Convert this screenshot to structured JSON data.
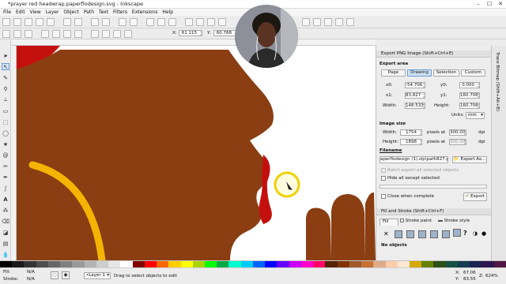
{
  "window": {
    "title": "*prayer red headwrap.paperflodesign.svg - Inkscape",
    "min": "–",
    "max": "☐",
    "close": "✕"
  },
  "menu": [
    "File",
    "Edit",
    "View",
    "Layer",
    "Object",
    "Path",
    "Text",
    "Filters",
    "Extensions",
    "Help"
  ],
  "toolctl": {
    "x_label": "X:",
    "x_value": "61.115",
    "y_label": "Y:",
    "y_value": "60.768"
  },
  "export": {
    "title": "Export PNG Image (Shift+Ctrl+E)",
    "area_label": "Export area",
    "tabs": [
      "Page",
      "Drawing",
      "Selection",
      "Custom"
    ],
    "x0_label": "x0:",
    "x0": "-54.706",
    "y0_label": "y0:",
    "y0": "0.000",
    "x1_label": "x1:",
    "x1": "83.827",
    "y1_label": "y1:",
    "y1": "160.706",
    "width_label": "Width:",
    "width": "148.533",
    "height_label": "Height:",
    "height": "160.706",
    "units_label": "Units:",
    "units": "mm",
    "image_size_label": "Image size",
    "img_width_label": "Width:",
    "img_width": "1754",
    "img_height_label": "Height:",
    "img_height": "1898",
    "pixels_at": "pixels at",
    "dpi1": "300.00",
    "dpi2": "300.00",
    "dpi_unit": "dpi",
    "filename_label": "Filename",
    "filename": "aperflodesign (1).zip\\path827.png",
    "export_as": "Export As...",
    "batch": "Batch export all selected objects",
    "hide": "Hide all except selected",
    "close_when": "Close when complete",
    "export_btn": "Export"
  },
  "fill_stroke": {
    "title": "Fill and Stroke (Shift+Ctrl+F)",
    "tabs": [
      "Fill",
      "Stroke paint",
      "Stroke style"
    ],
    "no_objects": "No objects"
  },
  "trace_tab": "Trace Bitmap (Shift+Alt+B)",
  "status": {
    "fill_label": "Fill:",
    "fill_value": "N/A",
    "stroke_label": "Stroke:",
    "stroke_value": "N/A",
    "layer": "•Layer 1",
    "message": "Drag to select objects to edit",
    "x_label": "X:",
    "x_value": "67.06",
    "y_label": "Y:",
    "y_value": "83.55",
    "z_label": "Z:",
    "zoom": "624%"
  },
  "colors": {
    "skin": "#8a3e12",
    "red": "#c4100d",
    "ring": "#f5b400",
    "accent": "#5e9d2c"
  }
}
